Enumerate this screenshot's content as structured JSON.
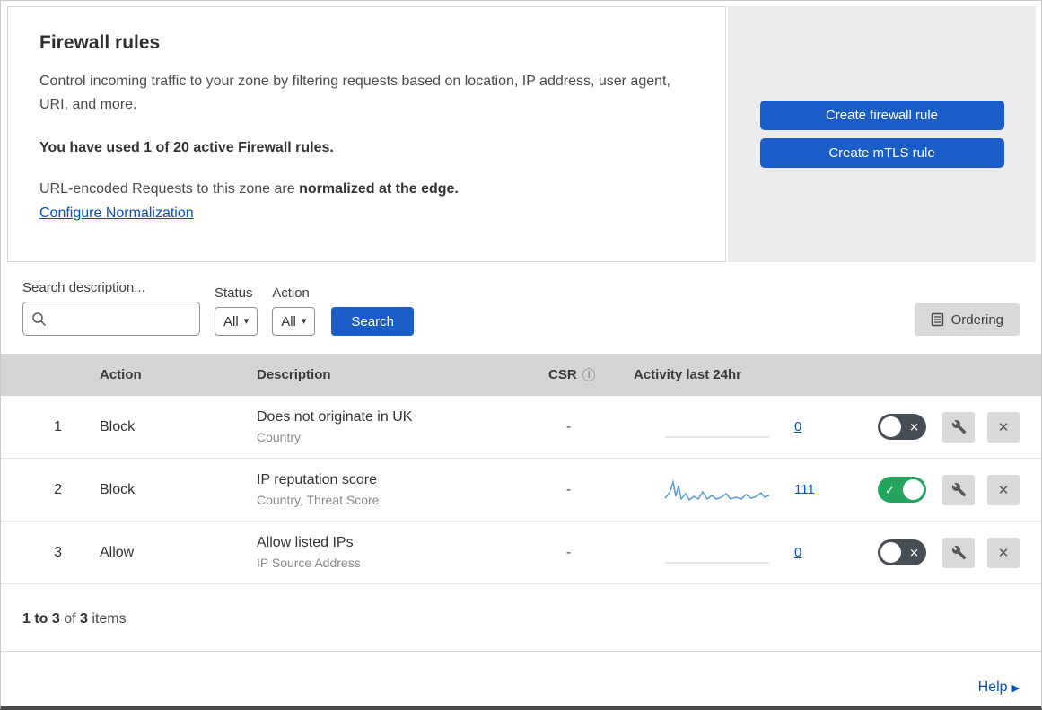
{
  "colors": {
    "accent": "#1a5cc8",
    "link": "#0051c3",
    "toggle_on": "#23a55e",
    "toggle_off": "#474d55",
    "header_bg": "#d5d5d5",
    "panel_bg": "#ececec",
    "control_bg": "#d9d9d9",
    "spark_blue": "#5b9bd5",
    "spark_gray": "#dcdcdc"
  },
  "icons": {
    "caret_down": "▾",
    "info": "ⓘ",
    "check": "✓",
    "close": "✕",
    "help_arrow": "▶"
  },
  "intro": {
    "title": "Firewall rules",
    "description": "Control incoming traffic to your zone by filtering requests based on location, IP address, user agent, URI, and more.",
    "usage": "You have used 1 of 20 active Firewall rules.",
    "normalization_text": "URL-encoded Requests to this zone are ",
    "normalization_bold": "normalized at the edge.",
    "normalization_link": "Configure Normalization"
  },
  "actions": {
    "create_firewall": "Create firewall rule",
    "create_mtls": "Create mTLS rule"
  },
  "filters": {
    "search_label": "Search description...",
    "status_label": "Status",
    "status_value": "All",
    "action_label": "Action",
    "action_value": "All",
    "search_button": "Search",
    "ordering_button": "Ordering"
  },
  "table": {
    "headers": {
      "action": "Action",
      "description": "Description",
      "csr": "CSR",
      "activity": "Activity last 24hr"
    },
    "rows": [
      {
        "num": "1",
        "action": "Block",
        "title": "Does not originate in UK",
        "subtitle": "Country",
        "csr": "-",
        "count": "0",
        "enabled": false,
        "sparkline": "2,27 118,27"
      },
      {
        "num": "2",
        "action": "Block",
        "title": "IP reputation score",
        "subtitle": "Country, Threat Score",
        "csr": "-",
        "count": "111",
        "enabled": true,
        "sparkline": "2,25 7,19 11,7 14,23 17,11 20,26 25,20 29,27 34,23 39,26 44,18 49,26 54,22 59,26 65,24 70,20 75,26 81,24 87,26 92,21 98,25 104,23 109,19 113,24 118,22"
      },
      {
        "num": "3",
        "action": "Allow",
        "title": "Allow listed IPs",
        "subtitle": "IP Source Address",
        "csr": "-",
        "count": "0",
        "enabled": false,
        "sparkline": "2,27 118,27"
      }
    ]
  },
  "footer": {
    "range": "1 to 3",
    "of": " of ",
    "total": "3",
    "items": " items"
  },
  "help": {
    "label": "Help"
  }
}
